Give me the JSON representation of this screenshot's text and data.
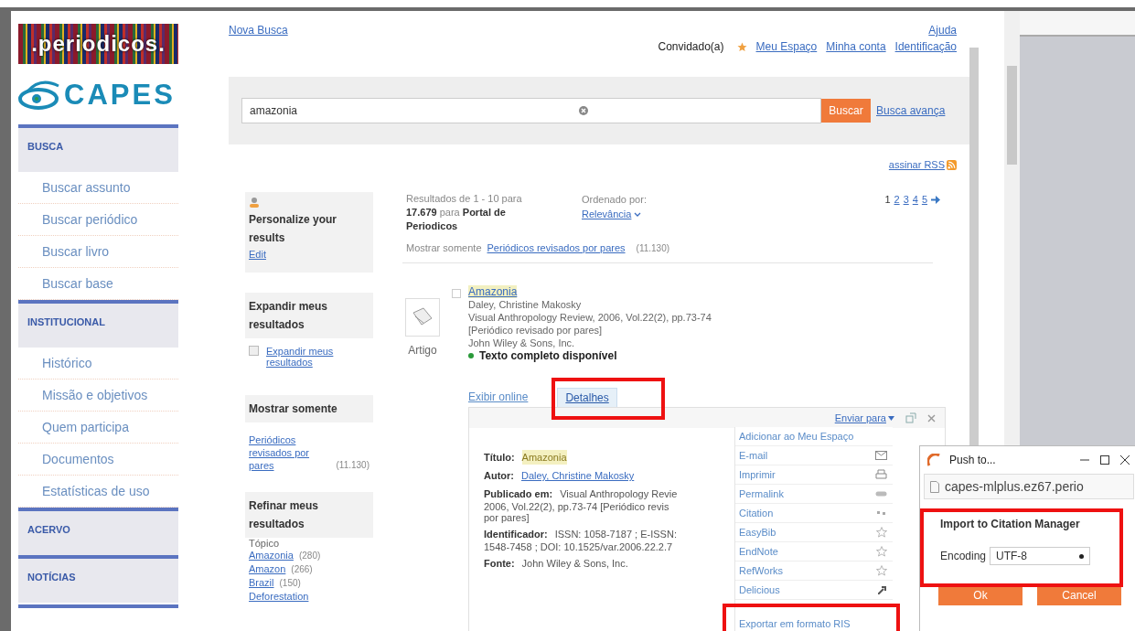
{
  "logo": {
    "text": ".periodicos.",
    "brand": "CAPES"
  },
  "sidebar": {
    "sections": [
      {
        "title": "BUSCA",
        "items": [
          "Buscar assunto",
          "Buscar periódico",
          "Buscar livro",
          "Buscar base"
        ]
      },
      {
        "title": "INSTITUCIONAL",
        "items": [
          "Histórico",
          "Missão e objetivos",
          "Quem participa",
          "Documentos",
          "Estatísticas de uso"
        ]
      },
      {
        "title": "ACERVO"
      },
      {
        "title": "NOTÍCIAS"
      }
    ]
  },
  "top": {
    "new_search": "Nova Busca",
    "help": "Ajuda",
    "user": "Convidado(a)",
    "links": [
      "Meu Espaço",
      "Minha conta",
      "Identificação"
    ]
  },
  "search": {
    "value": "amazonia",
    "button": "Buscar",
    "advanced": "Busca avança"
  },
  "rss": "assinar RSS",
  "facets": {
    "personalize": {
      "title": "Personalize your results",
      "link": "Edit"
    },
    "expand": {
      "title": "Expandir meus resultados",
      "checkbox": "Expandir meus resultados",
      "checked": false
    },
    "show_only": {
      "title": "Mostrar somente",
      "link": "Periódicos revisados por pares",
      "count": "(11.130)"
    },
    "refine": {
      "title": "Refinar meus resultados",
      "group": "Tópico",
      "items": [
        {
          "label": "Amazonia",
          "count": "(280)"
        },
        {
          "label": "Amazon",
          "count": "(266)"
        },
        {
          "label": "Brazil",
          "count": "(150)"
        },
        {
          "label": "Deforestation"
        }
      ]
    }
  },
  "results": {
    "summary": "Resultados de 1 - 10 para **17.679** para **Portal de Periodicos**",
    "sort_label": "Ordenado por:",
    "sort_value": "Relevância",
    "pages": [
      {
        "label": "1",
        "selected": true
      },
      {
        "label": "2",
        "selected": false
      },
      {
        "label": "3",
        "selected": false
      },
      {
        "label": "4",
        "selected": false
      },
      {
        "label": "5",
        "selected": false
      }
    ],
    "filter_label": "Mostrar somente",
    "filter_link": "Periódicos revisados por pares",
    "filter_count": "(11.130)"
  },
  "record": {
    "type": "Artigo",
    "checked": false,
    "title": "Amazonia",
    "lines": [
      "Daley, Christine Makosky",
      "Visual Anthropology Review, 2006, Vol.22(2), pp.73-74",
      "[Periódico revisado por pares]",
      "John Wiley & Sons, Inc."
    ],
    "fulltext": "Texto completo disponível",
    "tabs": [
      {
        "label": "Exibir online",
        "selected": false
      },
      {
        "label": "Detalhes",
        "selected": true
      }
    ]
  },
  "details": {
    "send_to": "Enviar para",
    "fields": [
      {
        "label": "Título:",
        "value": [
          "Amazonia"
        ],
        "kind": "highlight"
      },
      {
        "label": "Autor:",
        "value": [
          "Daley, Christine Makosky"
        ],
        "kind": "link"
      },
      {
        "label": "Publicado em:",
        "value": [
          "Visual Anthropology Revie",
          "2006, Vol.22(2), pp.73-74 [Periódico revis",
          "por pares]"
        ],
        "kind": "text"
      },
      {
        "label": "Identificador:",
        "value": [
          "ISSN: 1058-7187 ; E-ISSN:",
          "1548-7458 ; DOI: 10.1525/var.2006.22.2.7"
        ],
        "kind": "text"
      },
      {
        "label": "Fonte:",
        "value": [
          "John Wiley & Sons, Inc."
        ],
        "kind": "text"
      }
    ]
  },
  "send_menu": [
    "Adicionar ao Meu Espaço",
    "E-mail",
    "Imprimir",
    "Permalink",
    "Citation",
    "EasyBib",
    "EndNote",
    "RefWorks",
    "Delicious",
    "Exportar em formato RIS"
  ],
  "popup": {
    "title": "Push to...",
    "url": "capes-mlplus.ez67.perio",
    "heading": "Import to Citation Manager",
    "encoding_label": "Encoding",
    "encoding": "UTF-8",
    "buttons": [
      "Ok",
      "Cancel"
    ]
  }
}
